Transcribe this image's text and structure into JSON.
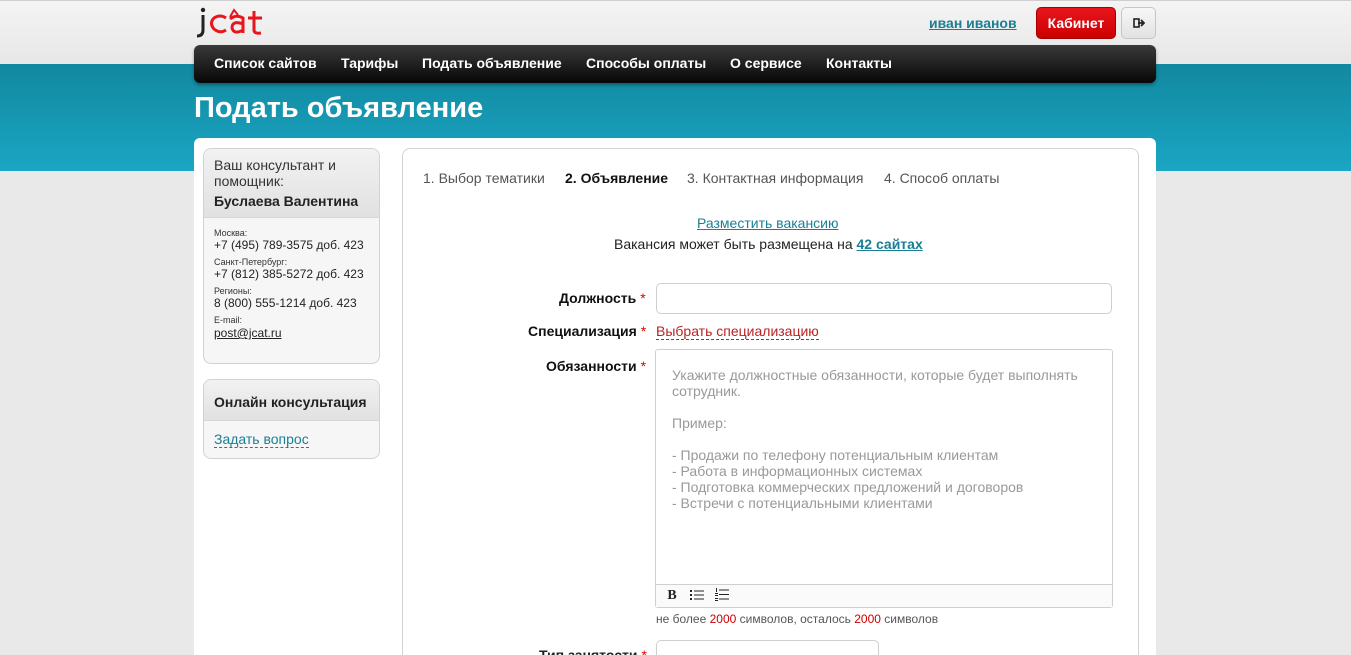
{
  "header": {
    "logo_text": "jcat",
    "user_name": "иван иванов",
    "cabinet_label": "Кабинет",
    "colors": {
      "brand_red": "#e8151d",
      "teal": "#1a9fbb",
      "link": "#1a7f95"
    }
  },
  "nav": {
    "items": [
      {
        "label": "Список сайтов"
      },
      {
        "label": "Тарифы"
      },
      {
        "label": "Подать объявление"
      },
      {
        "label": "Способы оплаты"
      },
      {
        "label": "О сервисе"
      },
      {
        "label": "Контакты"
      }
    ]
  },
  "page": {
    "title": "Подать объявление"
  },
  "sidebar": {
    "consultant": {
      "title": "Ваш консультант и помощник:",
      "name": "Буслаева Валентина",
      "contacts": [
        {
          "label": "Москва:",
          "value": "+7 (495) 789-3575 доб. 423"
        },
        {
          "label": "Санкт-Петербург:",
          "value": "+7 (812) 385-5272 доб. 423"
        },
        {
          "label": "Регионы:",
          "value": "8 (800) 555-1214 доб. 423"
        }
      ],
      "email_label": "E-mail:",
      "email": "post@jcat.ru"
    },
    "online": {
      "title": "Онлайн консультация",
      "ask_label": "Задать вопрос"
    }
  },
  "steps": [
    {
      "label": "1. Выбор тематики"
    },
    {
      "label": "2. Объявление"
    },
    {
      "label": "3. Контактная информация"
    },
    {
      "label": "4. Способ оплаты"
    }
  ],
  "vacancy": {
    "link": "Разместить вакансию",
    "note_prefix": "Вакансия может быть размещена на",
    "sites_link": "42 сайтах"
  },
  "form": {
    "required_mark": "*",
    "position_label": "Должность",
    "position_value": "",
    "specialization_label": "Специализация",
    "specialization_link": "Выбрать специализацию",
    "duties_label": "Обязанности",
    "duties_placeholder": {
      "intro_1": "Укажите должностные обязанности, которые будет выполнять",
      "intro_2": "сотрудник.",
      "example": "Пример:",
      "lines": [
        "- Продажи по телефону потенциальным клиентам",
        "- Работа в информационных системах",
        "- Подготовка коммерческих предложений и договоров",
        "- Встречи с потенциальными клиентами"
      ]
    },
    "toolbar": {
      "bold": "B"
    },
    "char_note": {
      "prefix": "не более",
      "max": "2000",
      "middle": "символов, осталось",
      "left": "2000",
      "suffix": "символов"
    },
    "employment_label": "Тип занятости"
  }
}
